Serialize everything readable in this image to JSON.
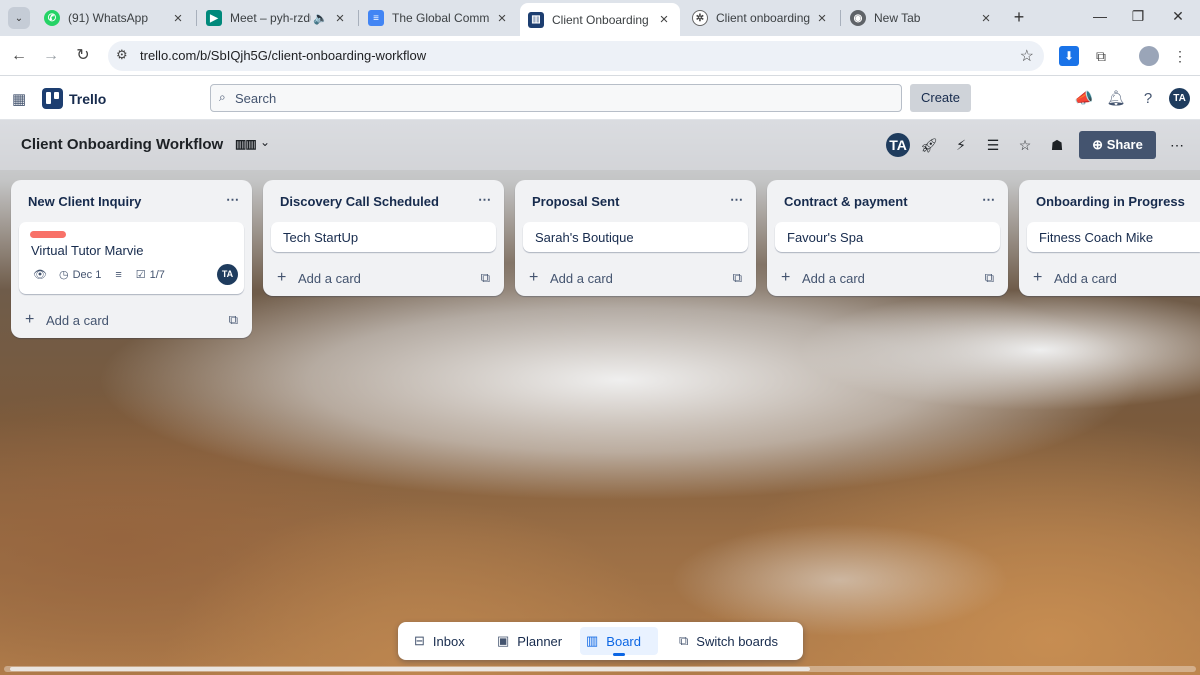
{
  "browser": {
    "tabs": [
      {
        "title": "(91) WhatsApp",
        "icon": "whatsapp-icon",
        "color": "#25d366"
      },
      {
        "title": "Meet – pyh-rzdu",
        "icon": "google-meet-icon",
        "color": "#00897b"
      },
      {
        "title": "The Global Commun",
        "icon": "google-docs-icon",
        "color": "#4285f4"
      },
      {
        "title": "Client Onboarding W",
        "icon": "trello-icon",
        "color": "#1d3e70"
      },
      {
        "title": "Client onboarding be",
        "icon": "chatgpt-icon",
        "color": "#444444"
      },
      {
        "title": "New Tab",
        "icon": "chrome-icon",
        "color": "#5f6368"
      }
    ],
    "url": "trello.com/b/SbIQjh5G/client-onboarding-workflow"
  },
  "header": {
    "app_name": "Trello",
    "search_placeholder": "Search",
    "create_label": "Create",
    "user_initials": "TA"
  },
  "board": {
    "title": "Client Onboarding Workflow",
    "member_initials": "TA",
    "share_label": "Share",
    "add_card_label": "Add a card",
    "lists": [
      {
        "title": "New Client Inquiry",
        "cards": [
          {
            "title": "Virtual Tutor Marvie",
            "label_color": "#f87168",
            "due": "Dec 1",
            "checklist": "1/7",
            "member": "TA"
          }
        ]
      },
      {
        "title": "Discovery Call Scheduled",
        "cards": [
          {
            "title": "Tech StartUp"
          }
        ]
      },
      {
        "title": "Proposal Sent",
        "cards": [
          {
            "title": "Sarah's Boutique"
          }
        ]
      },
      {
        "title": "Contract & payment",
        "cards": [
          {
            "title": "Favour's Spa"
          }
        ]
      },
      {
        "title": "Onboarding in Progress",
        "cards": [
          {
            "title": "Fitness Coach Mike"
          }
        ]
      }
    ]
  },
  "switcher": {
    "items": [
      "Inbox",
      "Planner",
      "Board",
      "Switch boards"
    ],
    "active": "Board"
  }
}
